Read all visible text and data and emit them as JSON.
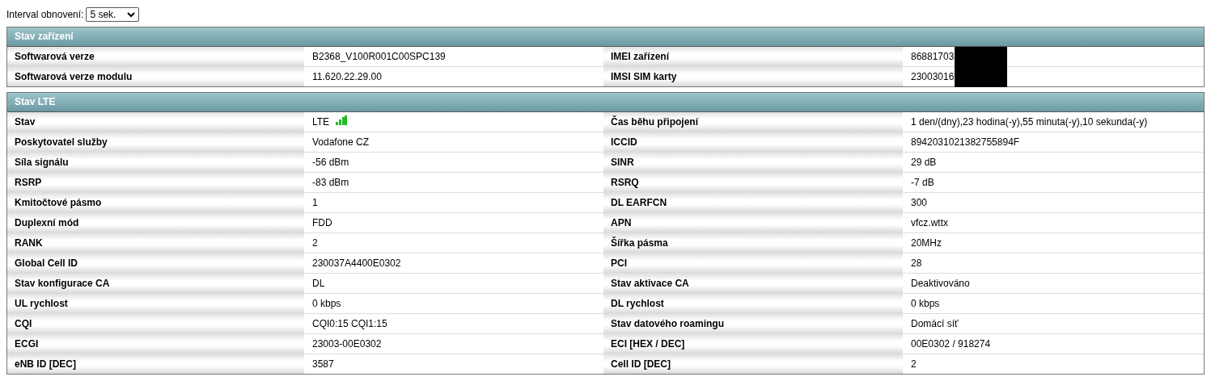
{
  "refresh": {
    "label": "Interval obnovení:",
    "value": "5 sek."
  },
  "sections": [
    {
      "title": "Stav zařízení",
      "rows": [
        [
          {
            "label": "Softwarová verze",
            "value": "B2368_V100R001C00SPC139"
          },
          {
            "label": "IMEI zařízení",
            "value": "86881703",
            "redacted": true
          }
        ],
        [
          {
            "label": "Softwarová verze modulu",
            "value": "11.620.22.29.00"
          },
          {
            "label": "IMSI SIM karty",
            "value": "23003016",
            "redacted": true
          }
        ]
      ]
    },
    {
      "title": "Stav LTE",
      "rows": [
        [
          {
            "label": "Stav",
            "value": "LTE",
            "kind": "network"
          },
          {
            "label": "Čas běhu připojení",
            "value": "1 den/(dny),23 hodina(-y),55 minuta(-y),10 sekunda(-y)"
          }
        ],
        [
          {
            "label": "Poskytovatel služby",
            "value": "Vodafone CZ"
          },
          {
            "label": "ICCID",
            "value": "8942031021382755894F"
          }
        ],
        [
          {
            "label": "Síla signálu",
            "value": "-56 dBm"
          },
          {
            "label": "SINR",
            "value": "29 dB"
          }
        ],
        [
          {
            "label": "RSRP",
            "value": "-83 dBm"
          },
          {
            "label": "RSRQ",
            "value": "-7 dB"
          }
        ],
        [
          {
            "label": "Kmitočtové pásmo",
            "value": "1"
          },
          {
            "label": "DL EARFCN",
            "value": "300"
          }
        ],
        [
          {
            "label": "Duplexní mód",
            "value": "FDD"
          },
          {
            "label": "APN",
            "value": "vfcz.wttx"
          }
        ],
        [
          {
            "label": "RANK",
            "value": "2"
          },
          {
            "label": "Šířka pásma",
            "value": "20MHz"
          }
        ],
        [
          {
            "label": "Global Cell ID",
            "value": "230037A4400E0302"
          },
          {
            "label": "PCI",
            "value": "28"
          }
        ],
        [
          {
            "label": "Stav konfigurace CA",
            "value": "DL"
          },
          {
            "label": "Stav aktivace CA",
            "value": "Deaktivováno"
          }
        ],
        [
          {
            "label": "UL rychlost",
            "value": "0 kbps"
          },
          {
            "label": "DL rychlost",
            "value": "0 kbps"
          }
        ],
        [
          {
            "label": "CQI",
            "value": "CQI0:15 CQI1:15"
          },
          {
            "label": "Stav datového roamingu",
            "value": "Domácí síť"
          }
        ],
        [
          {
            "label": "ECGI",
            "value": "23003-00E0302"
          },
          {
            "label": "ECI [HEX / DEC]",
            "value": "00E0302 / 918274"
          }
        ],
        [
          {
            "label": "eNB ID [DEC]",
            "value": "3587"
          },
          {
            "label": "Cell ID [DEC]",
            "value": "2"
          }
        ]
      ]
    }
  ]
}
